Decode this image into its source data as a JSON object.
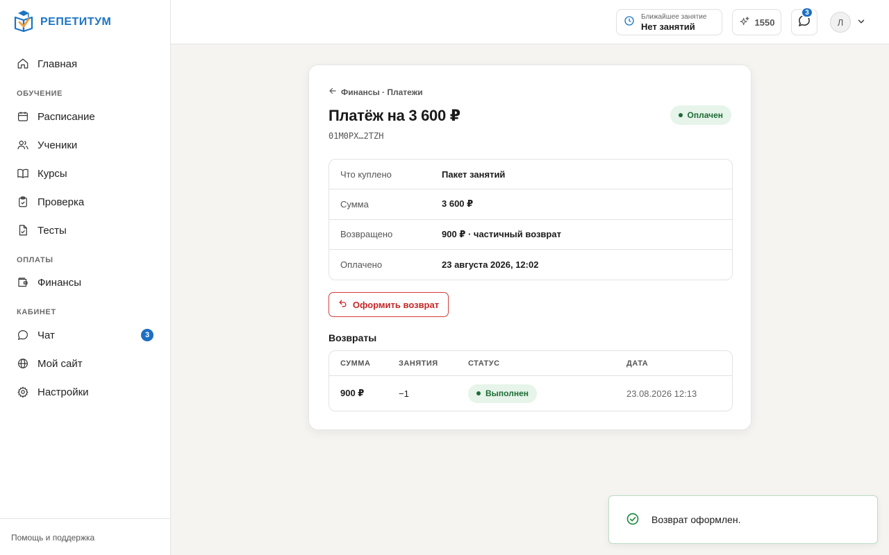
{
  "brand": {
    "name": "РЕПЕТИТУМ",
    "colors": {
      "primary": "#1d74c4",
      "accent": "#f2a03d",
      "success": "#1d6b34",
      "danger": "#c62828"
    }
  },
  "sidebar": {
    "home": "Главная",
    "sections": {
      "learning": "ОБУЧЕНИЕ",
      "payments": "ОПЛАТЫ",
      "cabinet": "КАБИНЕТ"
    },
    "items": {
      "schedule": "Расписание",
      "students": "Ученики",
      "courses": "Курсы",
      "review": "Проверка",
      "tests": "Тесты",
      "finance": "Финансы",
      "chat": "Чат",
      "chat_badge": "3",
      "site": "Мой сайт",
      "settings": "Настройки"
    },
    "footer": "Помощь и поддержка"
  },
  "header": {
    "next_lesson_label": "Ближайшее занятие",
    "next_lesson_value": "Нет занятий",
    "points": "1550",
    "chat_badge": "3",
    "avatar_initial": "Л"
  },
  "payment": {
    "breadcrumb": "Финансы · Платежи",
    "title": "Платёж на 3 600 ₽",
    "id": "01M0PX…2TZH",
    "status": "Оплачен",
    "details": [
      {
        "key": "Что куплено",
        "value": "Пакет занятий"
      },
      {
        "key": "Сумма",
        "value": "3 600 ₽"
      },
      {
        "key": "Возвращено",
        "value": "900 ₽ · частичный возврат"
      },
      {
        "key": "Оплачено",
        "value": "23 августа 2026, 12:02"
      }
    ],
    "refund_button": "Оформить возврат"
  },
  "refunds": {
    "title": "Возвраты",
    "columns": [
      "СУММА",
      "ЗАНЯТИЯ",
      "СТАТУС",
      "ДАТА"
    ],
    "rows": [
      {
        "amount": "900 ₽",
        "lessons": "−1",
        "status": "Выполнен",
        "date": "23.08.2026 12:13"
      }
    ]
  },
  "toast": {
    "message": "Возврат оформлен."
  }
}
